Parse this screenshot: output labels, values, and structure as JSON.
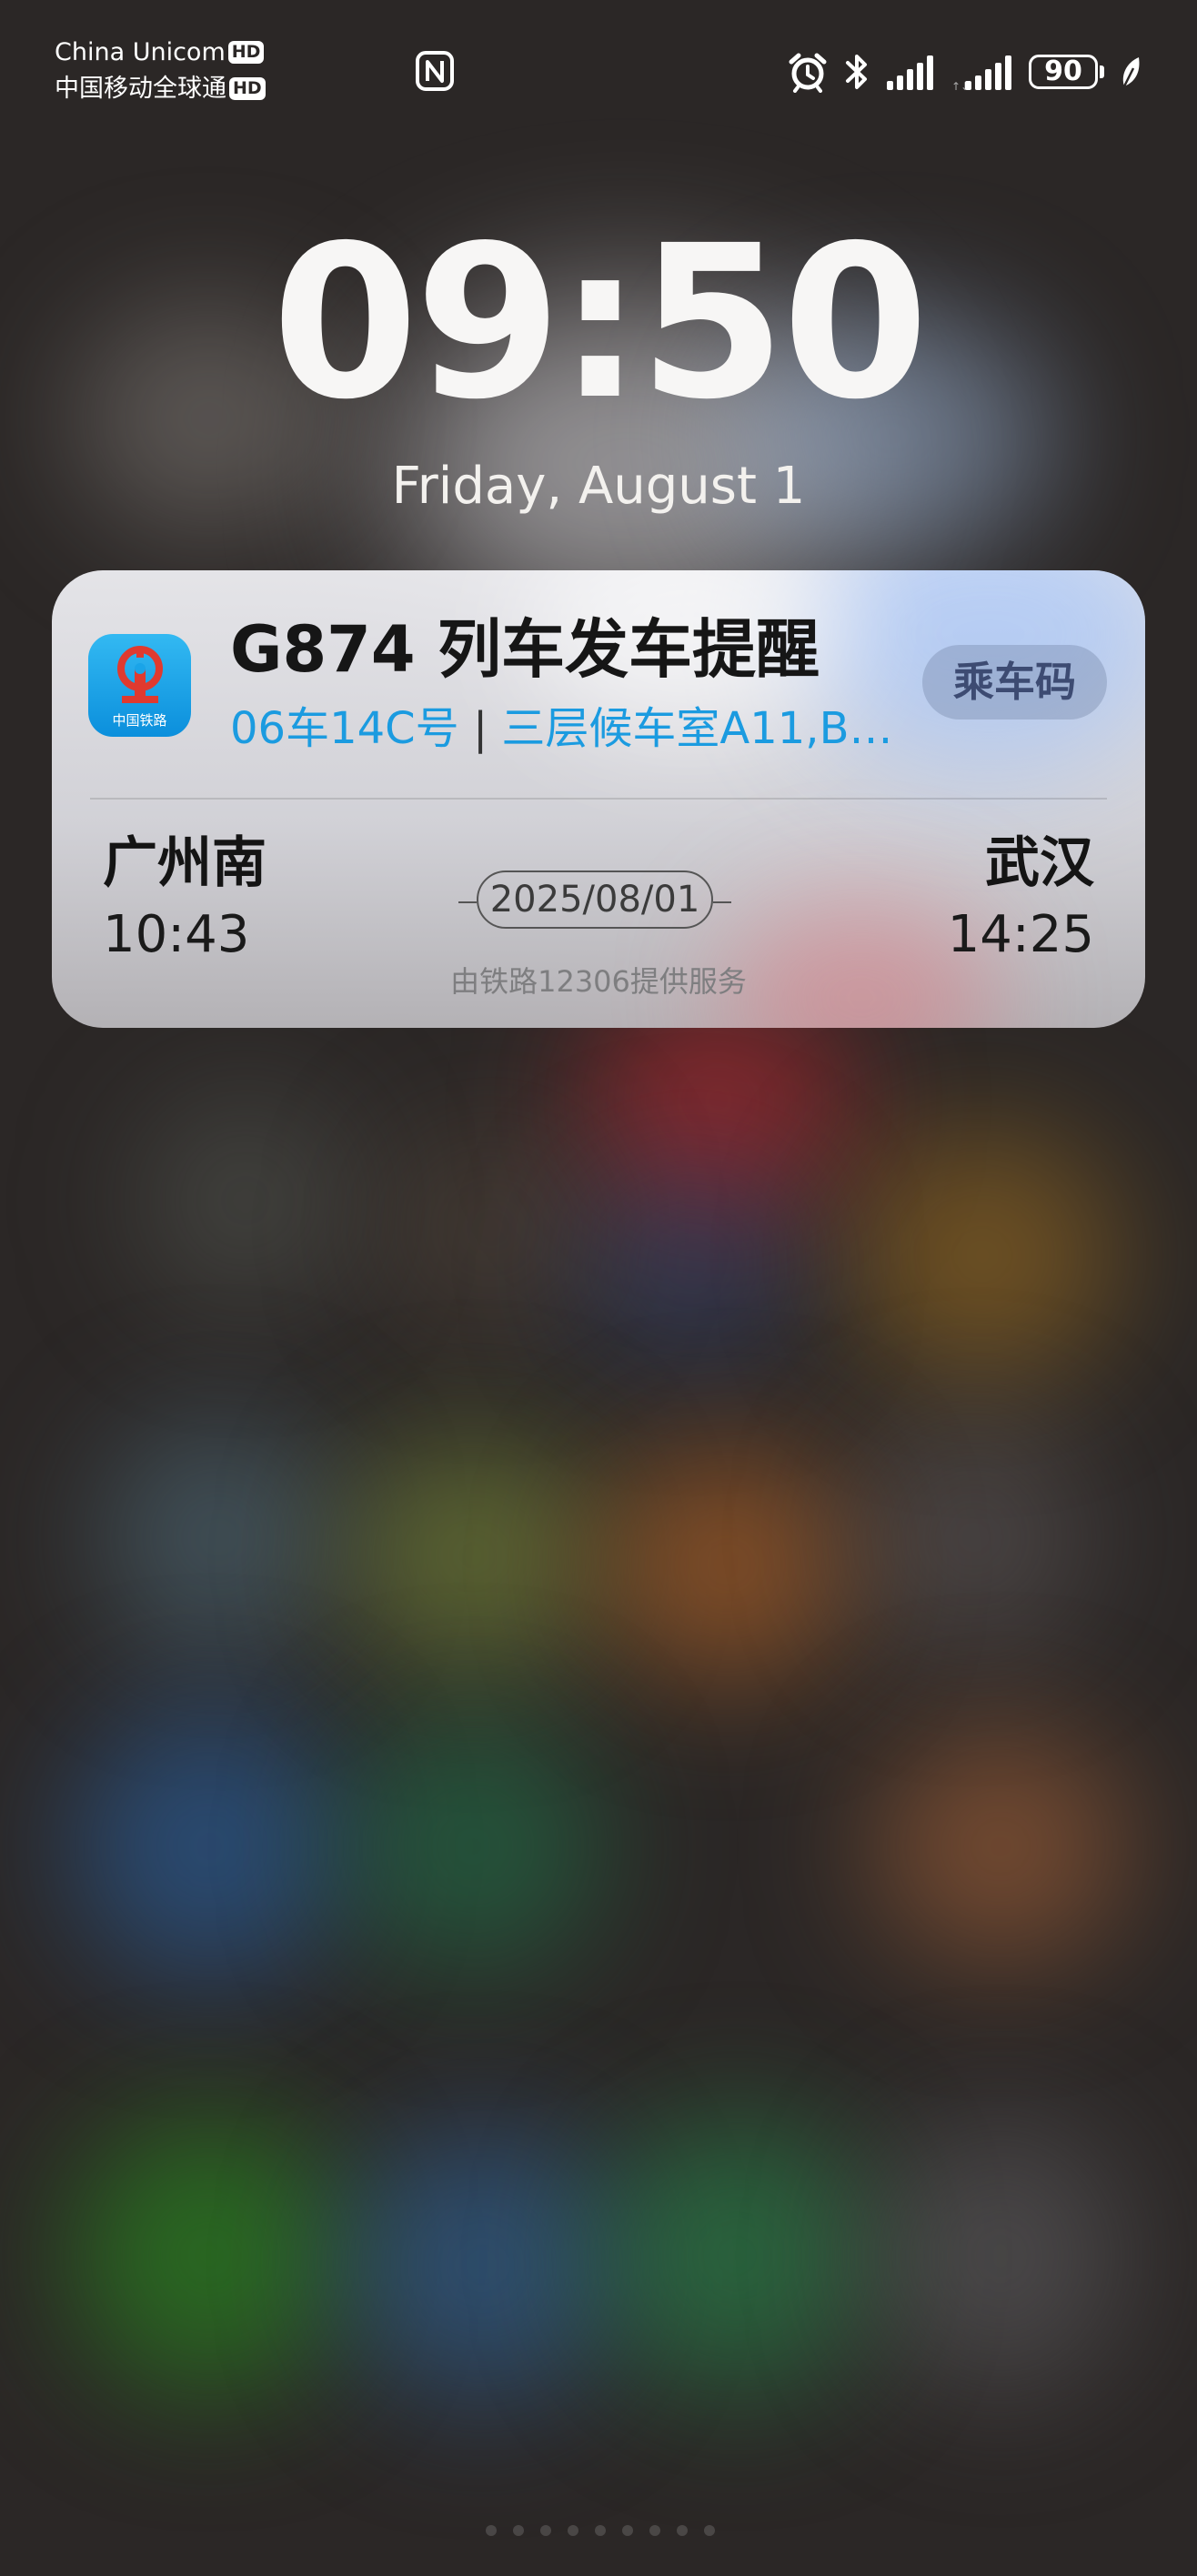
{
  "status_bar": {
    "carrier_1": "China Unicom",
    "carrier_2": "中国移动全球通",
    "hd_badge": "HD",
    "battery_level": "90"
  },
  "lockscreen": {
    "time": "09:50",
    "date": "Friday, August 1"
  },
  "notification": {
    "app_icon_label": "中国铁路",
    "title": "G874 列车发车提醒",
    "seat": "06车14C号",
    "separator": "|",
    "waiting_room": "三层候车室A11,B…",
    "action_button": "乘车码",
    "departure_station": "广州南",
    "departure_time": "10:43",
    "arrival_station": "武汉",
    "arrival_time": "14:25",
    "travel_date": "2025/08/01",
    "provider": "由铁路12306提供服务"
  },
  "colors": {
    "accent_blue": "#1b9be0",
    "railway_red": "#e03a2f",
    "app_icon_blue": "#1aa4e8"
  },
  "icons": [
    "nfc-icon",
    "alarm-icon",
    "bluetooth-icon",
    "signal-icon",
    "battery-icon",
    "eco-leaf-icon",
    "china-railway-logo-icon"
  ]
}
